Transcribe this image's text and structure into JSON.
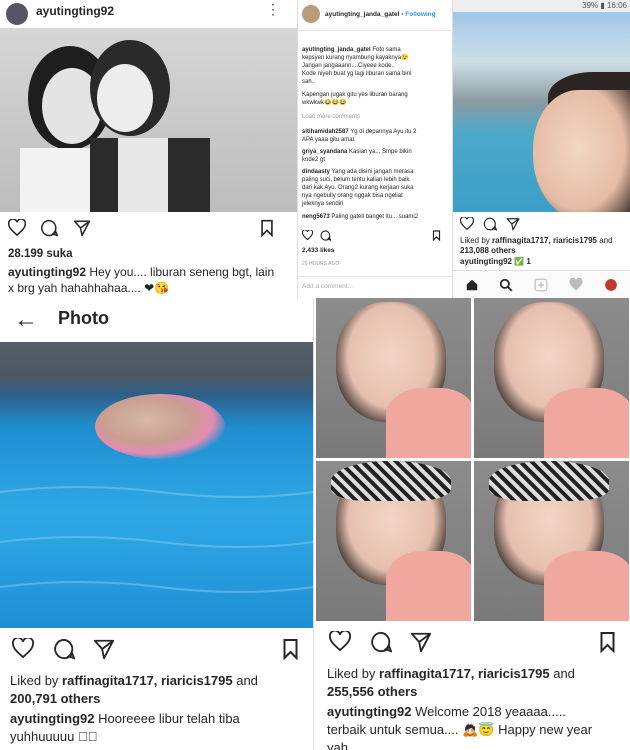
{
  "post1": {
    "username": "ayutingting92",
    "more": "⋮",
    "likes": "28.199 suka",
    "caption_user": "ayutingting92",
    "caption_l1": " Hey you.... liburan seneng bgt, lain",
    "caption_l2": "x brg yah hahahhahaa.... ❤😘"
  },
  "post2": {
    "username": "ayutingting_janda_gatel",
    "follow": "• Following",
    "comments": [
      {
        "user": "ayutingting_janda_gatel",
        "text": " Foto sama"
      },
      {
        "user": "",
        "text": "kepsyen kurang nyambung kayaknya😉"
      },
      {
        "user": "",
        "text": "Jangan jangaaann....Ciyeee kode.."
      },
      {
        "user": "",
        "text": "Kode niyeh buat yg lagi liburan sama bini"
      },
      {
        "user": "",
        "text": "sah.."
      },
      {
        "user": "",
        "text": "Kapengan jugak gitu yes liburan barang"
      },
      {
        "user": "",
        "text": "wkwkwk😂😂😂"
      }
    ],
    "load_more": "Load more comments",
    "thread": [
      {
        "user": "sitihamidah2587",
        "text": " Yg di depannya Ayu itu 2"
      },
      {
        "user": "",
        "text": "APA yaaa gitu amat"
      },
      {
        "user": "griya_syandana",
        "text": " Kasian ya... Smpe bikin"
      },
      {
        "user": "",
        "text": "kode2 gt"
      },
      {
        "user": "dindaasty",
        "text": " Yang ada disini jangan merasa"
      },
      {
        "user": "",
        "text": "paling suci, belum tentu kalian lebih baik"
      },
      {
        "user": "",
        "text": "dari kak Ayu. Orang2 kurang kerjaan suka"
      },
      {
        "user": "",
        "text": "nya ngebully orang nggak bisa ngeliat"
      },
      {
        "user": "",
        "text": "jeleknya sendiri"
      },
      {
        "user": "neng5673",
        "text": " Paling gatell banget itu... suami2"
      }
    ],
    "likes": "2,433 likes",
    "time": "20 HOURS AGO",
    "add_comment": "Add a comment..."
  },
  "post3": {
    "status_right": "39% ▮ 16:06",
    "liked_by_prefix": "Liked by ",
    "liked_by_users": "raffinagita1717, riaricis1795",
    "liked_by_suffix": " and",
    "others": "213,088 others",
    "username": "ayutingting92 ✅ 1"
  },
  "post4": {
    "title": "Photo",
    "liked_by_prefix": "Liked by ",
    "liked_by_users": "raffinagita1717, riaricis1795",
    "liked_by_suffix": " and",
    "others": "200,791 others",
    "caption_user": "ayutingting92",
    "caption_l1": " Hooreeee libur telah tiba",
    "caption_l2": "yuhhuuuuu ❤🏻"
  },
  "post5": {
    "liked_by_prefix": "Liked by ",
    "liked_by_users": "raffinagita1717, riaricis1795",
    "liked_by_suffix": " and",
    "others": "255,556 others",
    "caption_user": "ayutingting92",
    "caption_l1": " Welcome 2018 yeaaaa.....",
    "caption_l2": "terbaik untuk semua.... 🙇🏻😇 Happy new year",
    "caption_l3": "yah"
  },
  "icons": {
    "heart": "heart-icon",
    "comment": "comment-icon",
    "share": "share-icon",
    "bookmark": "bookmark-icon"
  }
}
